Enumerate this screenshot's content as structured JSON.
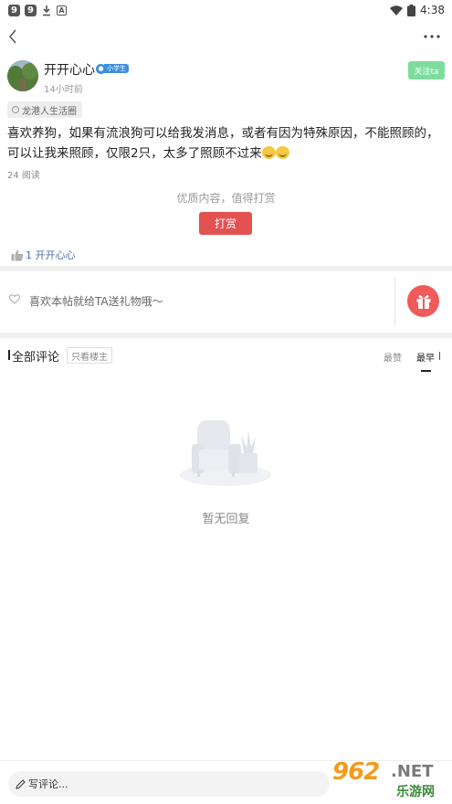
{
  "status_bar": {
    "time": "4:38",
    "icon_a": "A"
  },
  "author": {
    "name": "开开心心",
    "badge": "小学生",
    "time": "14小时前",
    "follow_label": "关注ta"
  },
  "circle": {
    "name": "龙港人生活圈"
  },
  "post": {
    "text": "喜欢养狗，如果有流浪狗可以给我发消息，或者有因为特殊原因，不能照顾的，可以让我来照顾，仅限2只，太多了照顾不过来",
    "read_count": "24 阅读"
  },
  "reward": {
    "prompt": "优质内容，值得打赏",
    "button_label": "打赏"
  },
  "likes": {
    "text": "1 开开心心"
  },
  "gift": {
    "prompt": "喜欢本帖就给TA送礼物哦～"
  },
  "comments": {
    "title": "全部评论",
    "filter_label": "只看楼主",
    "sort_options": [
      "最赞",
      "最早"
    ],
    "empty_text": "暂无回复"
  },
  "bottom_bar": {
    "input_placeholder": "写评论..."
  },
  "watermark": {
    "main": "962",
    "net": ".NET",
    "sub": "乐游网"
  },
  "colors": {
    "accent_red": "#e35151",
    "follow_green": "#7ddc9e",
    "badge_blue": "#3a8de0",
    "link_blue": "#4a6fa5"
  }
}
